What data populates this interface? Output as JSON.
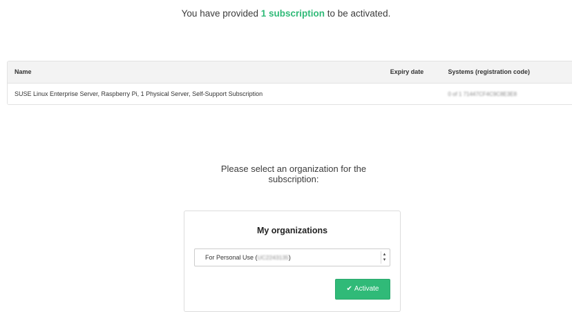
{
  "intro": {
    "prefix": "You have provided ",
    "count_text": "1 subscription",
    "suffix": " to be activated."
  },
  "table": {
    "headers": {
      "name": "Name",
      "expiry": "Expiry date",
      "systems": "Systems (registration code)"
    },
    "rows": [
      {
        "name": "SUSE Linux Enterprise Server, Raspberry Pi, 1 Physical Server, Self-Support Subscription",
        "expiry": "",
        "systems": "0 of 1 71447CF4C9C8E3E8"
      }
    ]
  },
  "prompt": {
    "line1": "Please select an organization for the",
    "line2": "subscription:"
  },
  "organizations": {
    "title": "My organizations",
    "selected_prefix": "For Personal Use (",
    "selected_code": "UC2243135",
    "selected_suffix": ")",
    "arrow_icon": "updown-arrow-icon",
    "activate_label": "Activate",
    "activate_icon": "check-icon"
  },
  "colors": {
    "accent": "#30ba78",
    "header_bg": "#f3f3f3",
    "border": "#e2e2e2"
  }
}
